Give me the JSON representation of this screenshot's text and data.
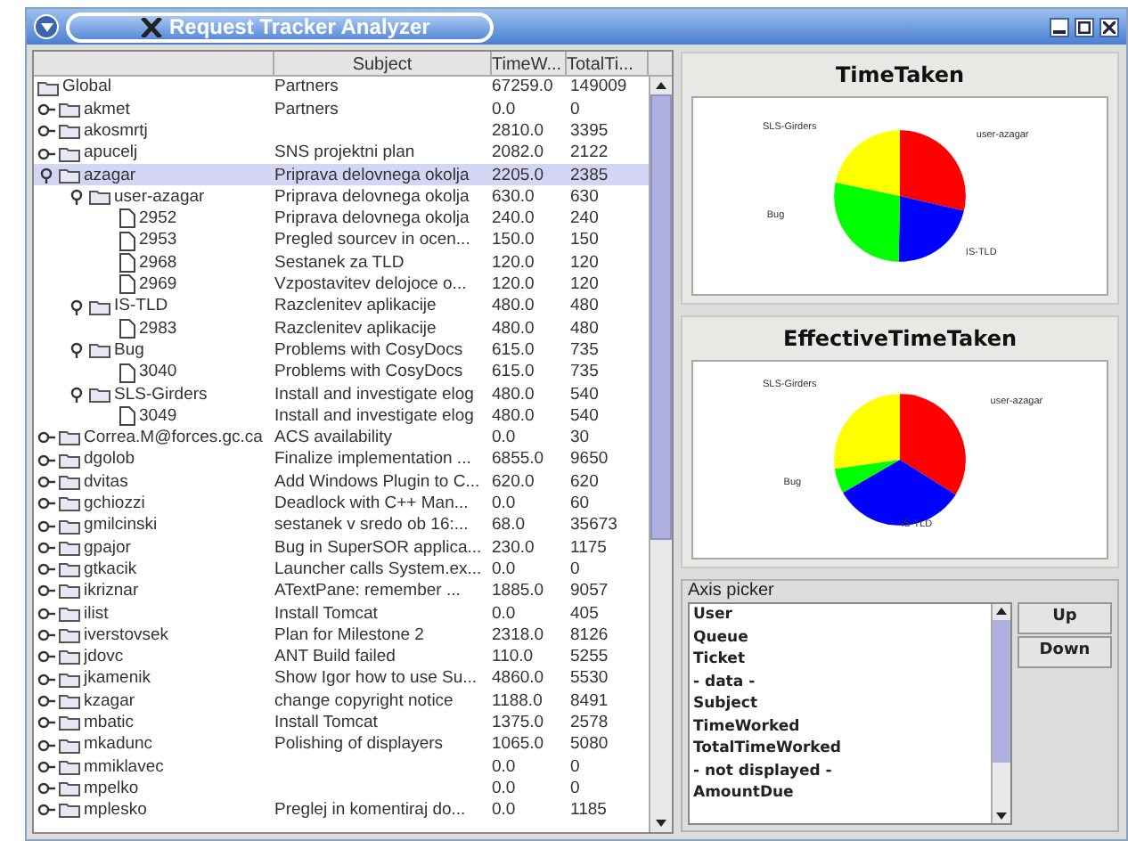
{
  "window": {
    "title": "Request Tracker Analyzer"
  },
  "table": {
    "columns": [
      {},
      {
        "label": "Subject"
      },
      {
        "label": "TimeW..."
      },
      {
        "label": "TotalTi..."
      }
    ],
    "tree": [
      {
        "name": "Global",
        "kind": "folder",
        "subject": "Partners",
        "time_worked": "67259.0",
        "total_time_worked": "149009",
        "selected": false,
        "children": [
          {
            "name": "akmet",
            "kind": "folder",
            "expanded": false,
            "selected": false,
            "subject": "Partners",
            "time_worked": "0.0",
            "total_time_worked": "0"
          },
          {
            "name": "akosmrtj",
            "kind": "folder",
            "expanded": false,
            "selected": false,
            "time_worked": "2810.0",
            "total_time_worked": "3395"
          },
          {
            "name": "apucelj",
            "kind": "folder",
            "expanded": false,
            "selected": false,
            "subject": "SNS projektni plan",
            "time_worked": "2082.0",
            "total_time_worked": "2122"
          },
          {
            "name": "azagar",
            "kind": "folder",
            "expanded": true,
            "selected": true,
            "subject": "Priprava delovnega okolja",
            "time_worked": "2205.0",
            "total_time_worked": "2385",
            "children": [
              {
                "name": "user-azagar",
                "kind": "folder",
                "expanded": true,
                "selected": false,
                "subject": "Priprava delovnega okolja",
                "time_worked": "630.0",
                "total_time_worked": "630",
                "children": [
                  {
                    "name": "2952",
                    "kind": "file",
                    "selected": false,
                    "subject": "Priprava delovnega okolja",
                    "time_worked": "240.0",
                    "total_time_worked": "240"
                  },
                  {
                    "name": "2953",
                    "kind": "file",
                    "selected": false,
                    "subject": "Pregled sourcev in ocen...",
                    "time_worked": "150.0",
                    "total_time_worked": "150"
                  },
                  {
                    "name": "2968",
                    "kind": "file",
                    "selected": false,
                    "subject": "Sestanek za TLD",
                    "time_worked": "120.0",
                    "total_time_worked": "120"
                  },
                  {
                    "name": "2969",
                    "kind": "file",
                    "selected": false,
                    "subject": "Vzpostavitev delojoce o...",
                    "time_worked": "120.0",
                    "total_time_worked": "120"
                  }
                ]
              },
              {
                "name": "IS-TLD",
                "kind": "folder",
                "expanded": true,
                "selected": false,
                "subject": "Razclenitev aplikacije",
                "time_worked": "480.0",
                "total_time_worked": "480",
                "children": [
                  {
                    "name": "2983",
                    "kind": "file",
                    "selected": false,
                    "subject": "Razclenitev aplikacije",
                    "time_worked": "480.0",
                    "total_time_worked": "480"
                  }
                ]
              },
              {
                "name": "Bug",
                "kind": "folder",
                "expanded": true,
                "selected": false,
                "subject": "Problems with CosyDocs",
                "time_worked": "615.0",
                "total_time_worked": "735",
                "children": [
                  {
                    "name": "3040",
                    "kind": "file",
                    "selected": false,
                    "subject": "Problems with CosyDocs",
                    "time_worked": "615.0",
                    "total_time_worked": "735"
                  }
                ]
              },
              {
                "name": "SLS-Girders",
                "kind": "folder",
                "expanded": true,
                "selected": false,
                "subject": "Install and investigate elog",
                "time_worked": "480.0",
                "total_time_worked": "540",
                "children": [
                  {
                    "name": "3049",
                    "kind": "file",
                    "selected": false,
                    "subject": "Install and investigate elog",
                    "time_worked": "480.0",
                    "total_time_worked": "540"
                  }
                ]
              }
            ]
          },
          {
            "name": "Correa.M@forces.gc.ca",
            "kind": "folder",
            "expanded": false,
            "selected": false,
            "subject": "ACS availability",
            "time_worked": "0.0",
            "total_time_worked": "30"
          },
          {
            "name": "dgolob",
            "kind": "folder",
            "expanded": false,
            "selected": false,
            "subject": "Finalize implementation ...",
            "time_worked": "6855.0",
            "total_time_worked": "9650"
          },
          {
            "name": "dvitas",
            "kind": "folder",
            "expanded": false,
            "selected": false,
            "subject": "Add Windows Plugin to C...",
            "time_worked": "620.0",
            "total_time_worked": "620"
          },
          {
            "name": "gchiozzi",
            "kind": "folder",
            "expanded": false,
            "selected": false,
            "subject": "Deadlock with C++ Man...",
            "time_worked": "0.0",
            "total_time_worked": "60"
          },
          {
            "name": "gmilcinski",
            "kind": "folder",
            "expanded": false,
            "selected": false,
            "subject": "sestanek v sredo ob 16:...",
            "time_worked": "68.0",
            "total_time_worked": "35673"
          },
          {
            "name": "gpajor",
            "kind": "folder",
            "expanded": false,
            "selected": false,
            "subject": "Bug in SuperSOR applica...",
            "time_worked": "230.0",
            "total_time_worked": "1175"
          },
          {
            "name": "gtkacik",
            "kind": "folder",
            "expanded": false,
            "selected": false,
            "subject": "Launcher calls System.ex...",
            "time_worked": "0.0",
            "total_time_worked": "0"
          },
          {
            "name": "ikriznar",
            "kind": "folder",
            "expanded": false,
            "selected": false,
            "subject": "ATextPane: remember ...",
            "time_worked": "1885.0",
            "total_time_worked": "9057"
          },
          {
            "name": "ilist",
            "kind": "folder",
            "expanded": false,
            "selected": false,
            "subject": "Install Tomcat",
            "time_worked": "0.0",
            "total_time_worked": "405"
          },
          {
            "name": "iverstovsek",
            "kind": "folder",
            "expanded": false,
            "selected": false,
            "subject": "Plan for Milestone 2",
            "time_worked": "2318.0",
            "total_time_worked": "8126"
          },
          {
            "name": "jdovc",
            "kind": "folder",
            "expanded": false,
            "selected": false,
            "subject": "ANT Build failed",
            "time_worked": "110.0",
            "total_time_worked": "5255"
          },
          {
            "name": "jkamenik",
            "kind": "folder",
            "expanded": false,
            "selected": false,
            "subject": "Show Igor how to use Su...",
            "time_worked": "4860.0",
            "total_time_worked": "5530"
          },
          {
            "name": "kzagar",
            "kind": "folder",
            "expanded": false,
            "selected": false,
            "subject": "change copyright notice",
            "time_worked": "1188.0",
            "total_time_worked": "8491"
          },
          {
            "name": "mbatic",
            "kind": "folder",
            "expanded": false,
            "selected": false,
            "subject": "Install Tomcat",
            "time_worked": "1375.0",
            "total_time_worked": "2578"
          },
          {
            "name": "mkadunc",
            "kind": "folder",
            "expanded": false,
            "selected": false,
            "subject": "Polishing of displayers",
            "time_worked": "1065.0",
            "total_time_worked": "5080"
          },
          {
            "name": "mmiklavec",
            "kind": "folder",
            "expanded": false,
            "selected": false,
            "time_worked": "0.0",
            "total_time_worked": "0"
          },
          {
            "name": "mpelko",
            "kind": "folder",
            "expanded": false,
            "selected": false,
            "time_worked": "0.0",
            "total_time_worked": "0"
          },
          {
            "name": "mplesko",
            "kind": "folder",
            "expanded": false,
            "selected": false,
            "subject": "Preglej in komentiraj do...",
            "time_worked": "0.0",
            "total_time_worked": "1185"
          }
        ]
      }
    ]
  },
  "charts": [
    {
      "title": "TimeTaken",
      "slices": [
        {
          "label": "user-azagar",
          "color": "#ff0000"
        },
        {
          "label": "IS-TLD",
          "color": "#0000ff"
        },
        {
          "label": "Bug",
          "color": "#00ff00"
        },
        {
          "label": "SLS-Girders",
          "color": "#ffff00"
        }
      ]
    },
    {
      "title": "EffectiveTimeTaken",
      "slices": [
        {
          "label": "user-azagar",
          "color": "#ff0000"
        },
        {
          "label": "IS-TLD",
          "color": "#0000ff"
        },
        {
          "label": "Bug",
          "color": "#00ff00"
        },
        {
          "label": "SLS-Girders",
          "color": "#ffff00"
        }
      ]
    }
  ],
  "axis_picker": {
    "title": "Axis picker",
    "items": [
      "User",
      "Queue",
      "Ticket",
      "- data -",
      "Subject",
      "TimeWorked",
      "TotalTimeWorked",
      "- not displayed -",
      "AmountDue"
    ],
    "buttons": [
      "Up",
      "Down"
    ]
  }
}
